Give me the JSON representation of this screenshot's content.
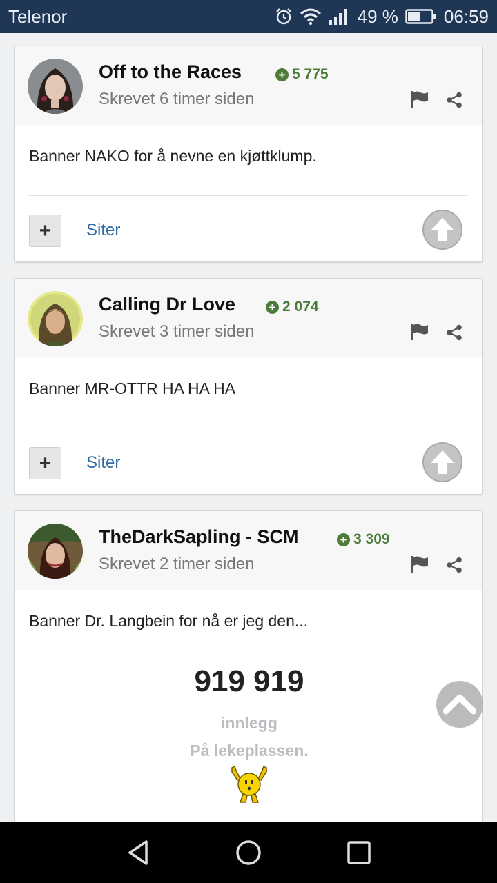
{
  "status_bar": {
    "carrier": "Telenor",
    "battery": "49 %",
    "time": "06:59",
    "icons": [
      "alarm-icon",
      "wifi-icon",
      "signal-icon",
      "battery-icon"
    ]
  },
  "posts": [
    {
      "author": "Off to the Races",
      "reputation": "5 775",
      "timestamp": "Skrevet 6 timer siden",
      "body": "Banner NAKO for å nevne en kjøttklump.",
      "quote_label": "Siter",
      "plus_label": "+"
    },
    {
      "author": "Calling Dr Love",
      "reputation": "2 074",
      "timestamp": "Skrevet 3 timer siden",
      "body": "Banner MR-OTTR HA HA HA",
      "quote_label": "Siter",
      "plus_label": "+"
    },
    {
      "author": "TheDarkSapling - SCM",
      "reputation": "3 309",
      "timestamp": "Skrevet 2 timer siden",
      "body": "Banner Dr. Langbein for nå er jeg den...",
      "signature": {
        "count": "919 919",
        "line1": "innlegg",
        "line2": "På lekeplassen."
      }
    }
  ],
  "colors": {
    "status_bar": "#1f3654",
    "reputation": "#4d7c3a",
    "link": "#2d6aa6"
  }
}
